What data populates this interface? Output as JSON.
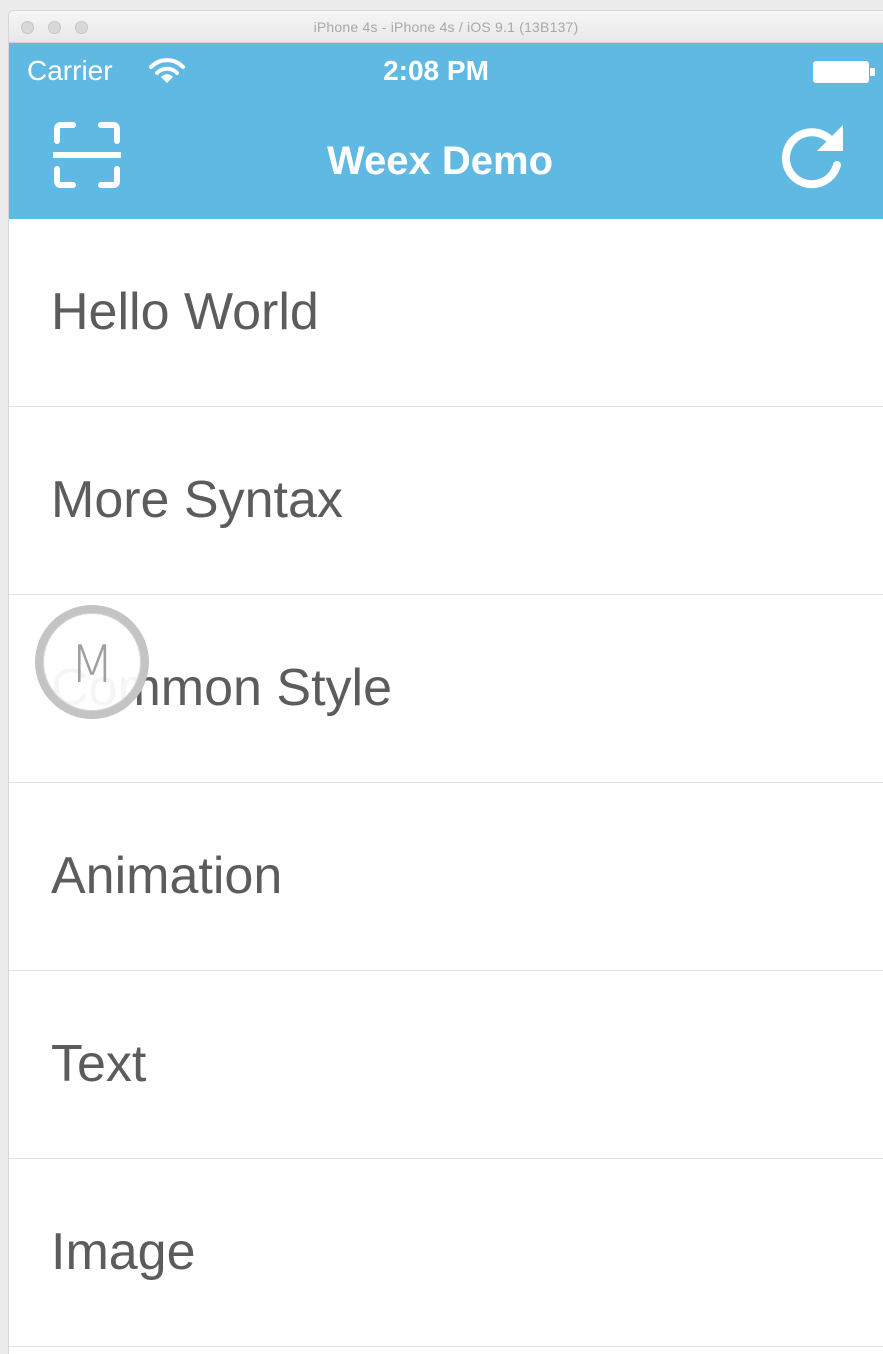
{
  "window": {
    "title": "iPhone 4s - iPhone 4s / iOS 9.1 (13B137)"
  },
  "status_bar": {
    "carrier": "Carrier",
    "time": "2:08 PM"
  },
  "nav_bar": {
    "title": "Weex Demo",
    "left_icon": "scan-icon",
    "right_icon": "refresh-icon",
    "background_color": "#60b9e3"
  },
  "list": {
    "items": [
      {
        "label": "Hello World"
      },
      {
        "label": "More Syntax"
      },
      {
        "label": "Common Style"
      },
      {
        "label": "Animation"
      },
      {
        "label": "Text"
      },
      {
        "label": "Image"
      }
    ]
  },
  "touch_indicator": {
    "letter": "M"
  }
}
